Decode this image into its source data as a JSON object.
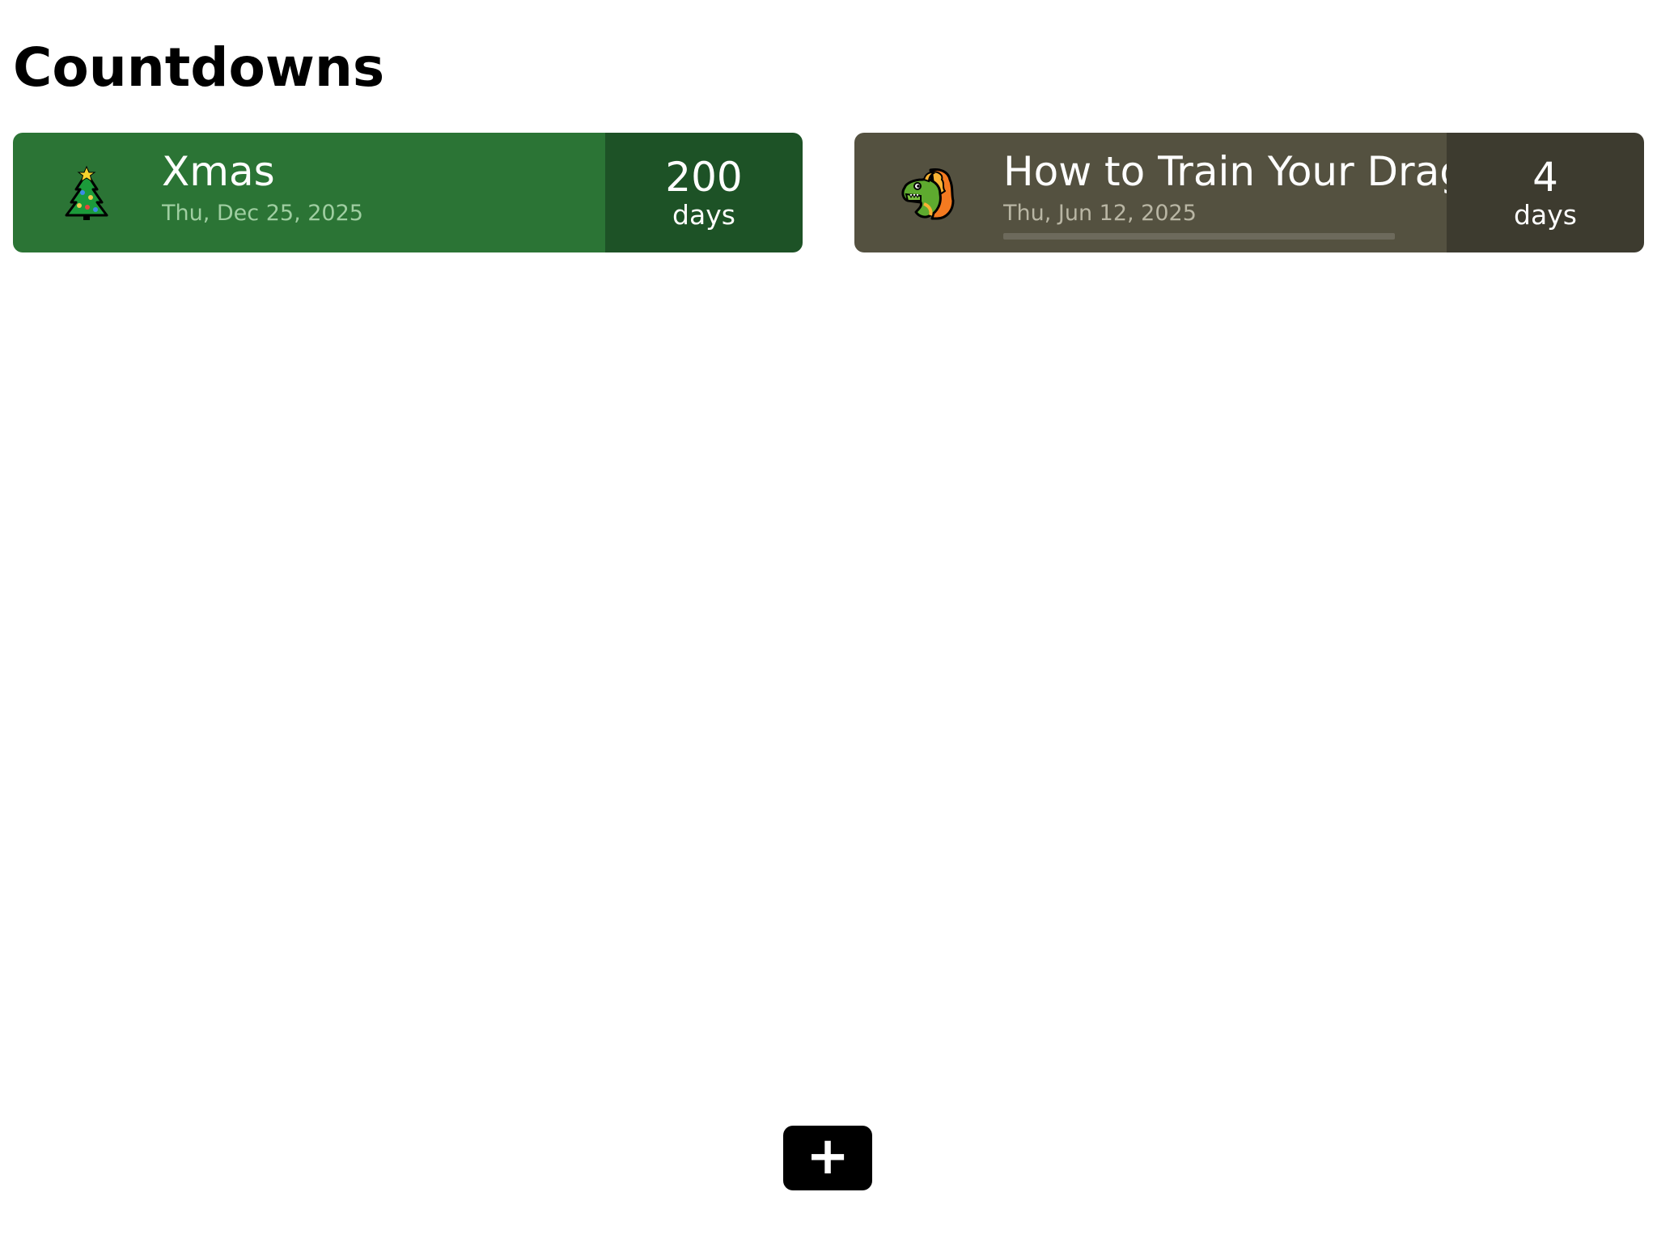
{
  "header": {
    "title": "Countdowns"
  },
  "countdowns": [
    {
      "title": "Xmas",
      "date": "Thu, Dec 25, 2025",
      "count": "200",
      "unit": "days",
      "icon": "christmas-tree-icon",
      "color_main": "#2b7435",
      "color_count": "#1d5226"
    },
    {
      "title": "How to Train Your Dragon",
      "date": "Thu, Jun 12, 2025",
      "count": "4",
      "unit": "days",
      "icon": "dragon-face-icon",
      "color_main": "#545140",
      "color_count": "#3d3b2f"
    }
  ],
  "actions": {
    "add_label": "+",
    "add_icon": "plus-icon"
  }
}
